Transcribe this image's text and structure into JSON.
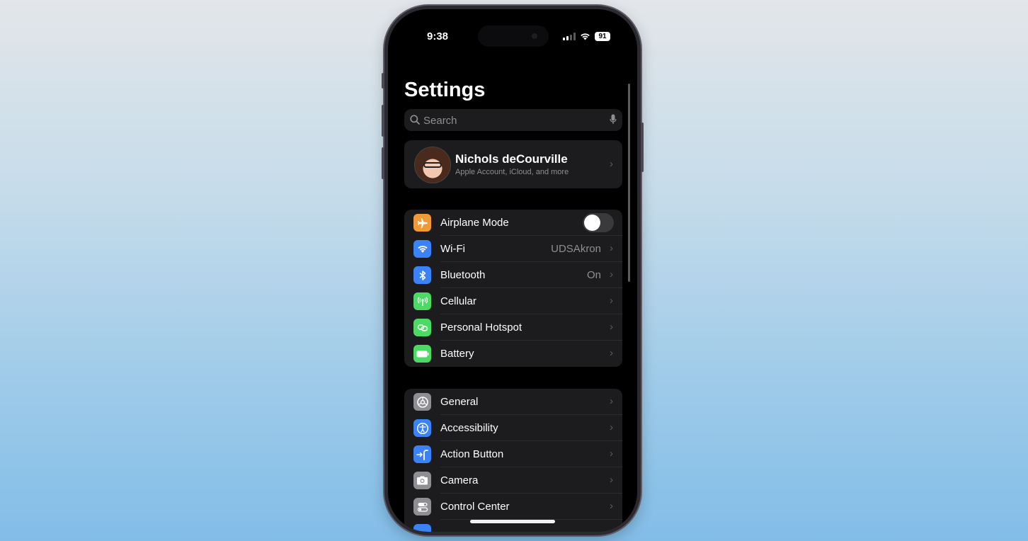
{
  "status_bar": {
    "time": "9:38",
    "battery": "91"
  },
  "title": "Settings",
  "search": {
    "placeholder": "Search"
  },
  "profile": {
    "name": "Nichols deCourville",
    "subtitle": "Apple Account, iCloud, and more"
  },
  "group1": [
    {
      "label": "Airplane Mode",
      "icon": "airplane-icon",
      "color": "#f09a37",
      "toggle": false
    },
    {
      "label": "Wi-Fi",
      "icon": "wifi-icon",
      "color": "#3b82f6",
      "value": "UDSAkron"
    },
    {
      "label": "Bluetooth",
      "icon": "bluetooth-icon",
      "color": "#3b82f6",
      "value": "On"
    },
    {
      "label": "Cellular",
      "icon": "cellular-icon",
      "color": "#4cd964"
    },
    {
      "label": "Personal Hotspot",
      "icon": "hotspot-icon",
      "color": "#4cd964"
    },
    {
      "label": "Battery",
      "icon": "battery-icon",
      "color": "#4cd964"
    }
  ],
  "group2": [
    {
      "label": "General",
      "icon": "gear-icon",
      "color": "#8e8e93"
    },
    {
      "label": "Accessibility",
      "icon": "accessibility-icon",
      "color": "#3b82f6"
    },
    {
      "label": "Action Button",
      "icon": "action-button-icon",
      "color": "#3b82f6"
    },
    {
      "label": "Camera",
      "icon": "camera-icon",
      "color": "#8e8e93"
    },
    {
      "label": "Control Center",
      "icon": "control-center-icon",
      "color": "#8e8e93"
    }
  ]
}
